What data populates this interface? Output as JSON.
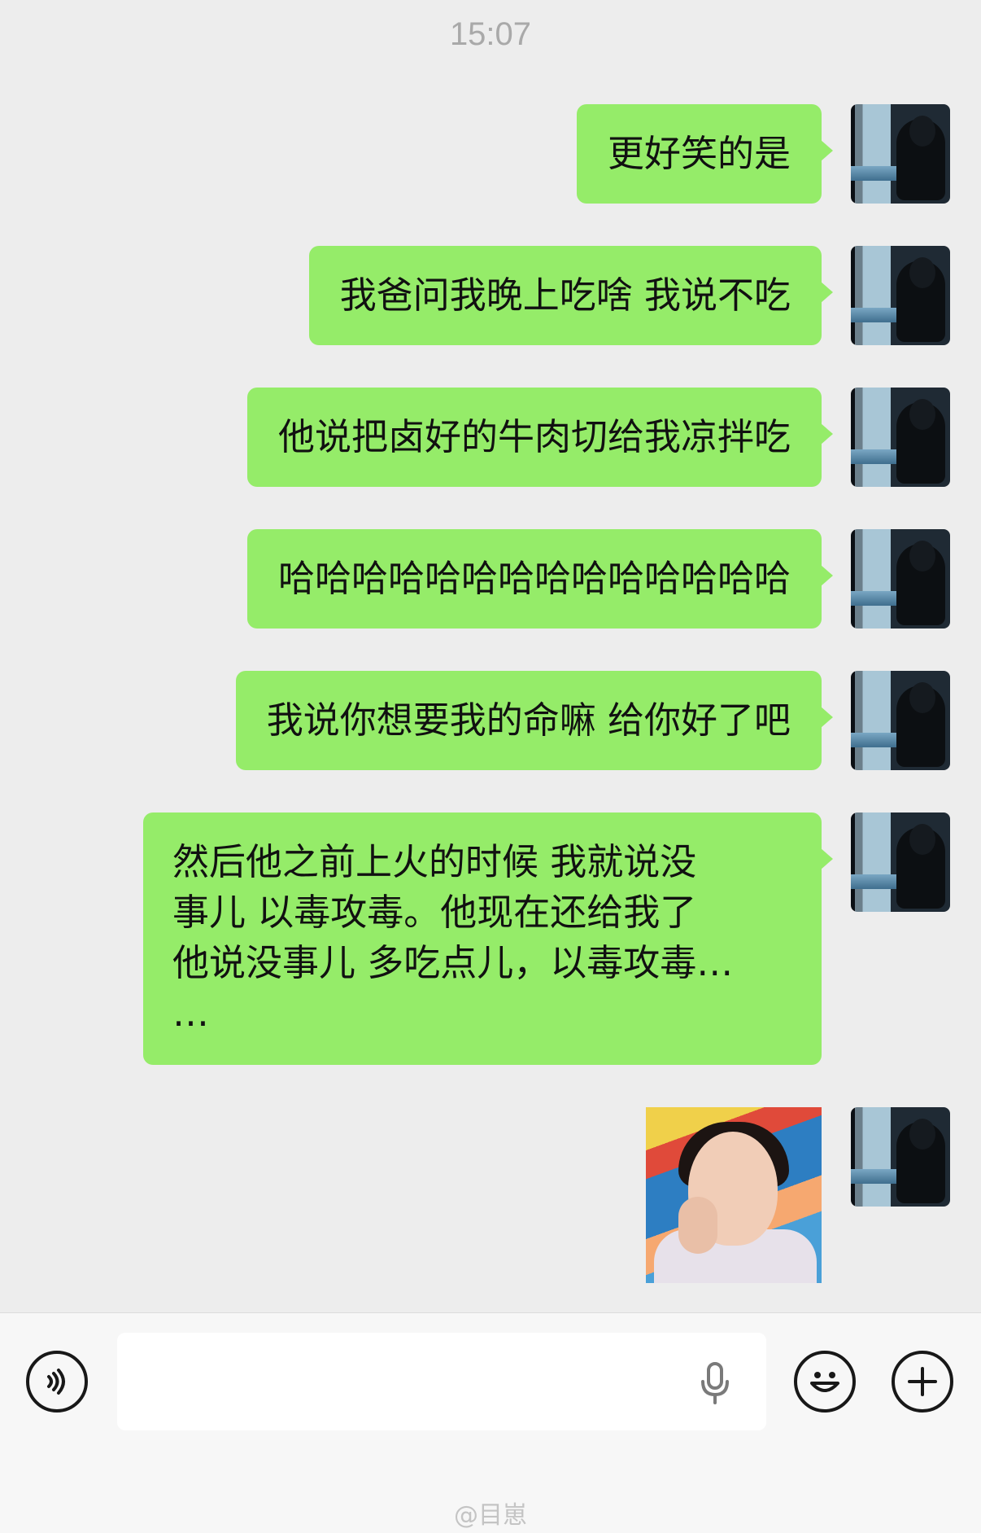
{
  "status": {
    "time": "15:07"
  },
  "messages": [
    {
      "text": "更好笑的是"
    },
    {
      "text": "我爸问我晚上吃啥 我说不吃"
    },
    {
      "text": "他说把卤好的牛肉切给我凉拌吃"
    },
    {
      "text": "哈哈哈哈哈哈哈哈哈哈哈哈哈哈"
    },
    {
      "text": "我说你想要我的命嘛 给你好了吧"
    },
    {
      "lines": [
        "然后他之前上火的时候 我就说没",
        "事儿 以毒攻毒。他现在还给我了",
        "他说没事儿 多吃点儿，以毒攻毒…",
        "…"
      ]
    }
  ],
  "input": {
    "placeholder": ""
  },
  "icons": {
    "voice": "voice-icon",
    "microphone": "microphone-icon",
    "emoji": "emoji-icon",
    "plus": "plus-icon"
  },
  "watermark": "@目崽"
}
